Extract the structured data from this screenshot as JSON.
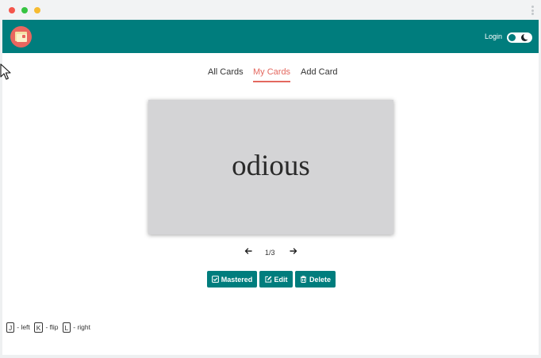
{
  "nav": {
    "login_label": "Login"
  },
  "tabs": [
    {
      "label": "All Cards"
    },
    {
      "label": "My Cards",
      "active": true
    },
    {
      "label": "Add Card"
    }
  ],
  "card": {
    "word": "odious"
  },
  "pager": {
    "position": "1/3"
  },
  "actions": {
    "mastered_label": "Mastered",
    "edit_label": "Edit",
    "delete_label": "Delete"
  },
  "shortcuts": [
    {
      "key": "J",
      "label": "- left"
    },
    {
      "key": "K",
      "label": "- flip"
    },
    {
      "key": "L",
      "label": "- right"
    }
  ],
  "colors": {
    "brand": "#007d7d",
    "accent": "#e4685f",
    "card_bg": "#d4d4d6"
  }
}
